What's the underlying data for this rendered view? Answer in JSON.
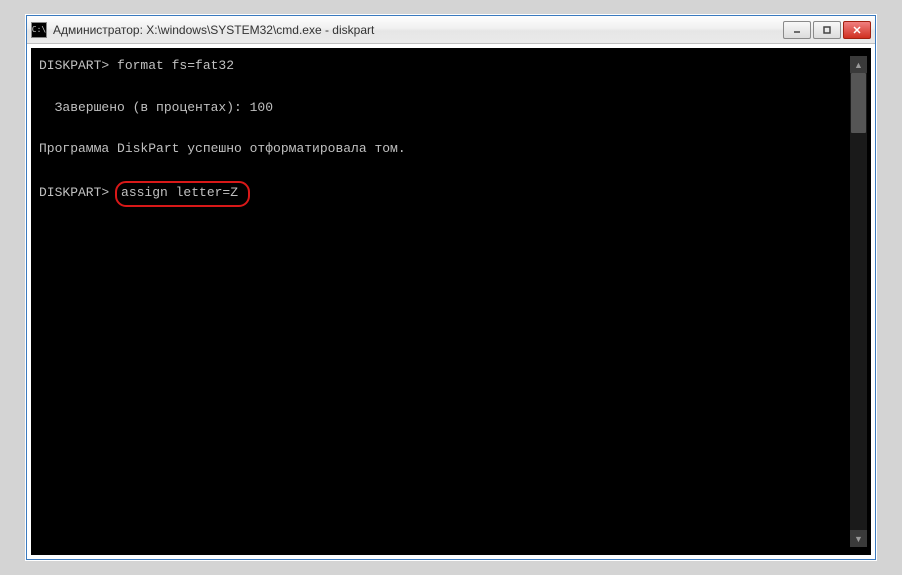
{
  "window": {
    "title": "Администратор: X:\\windows\\SYSTEM32\\cmd.exe - diskpart",
    "icon_label": "C:\\"
  },
  "console": {
    "lines": [
      {
        "prompt": "DISKPART>",
        "command": "format fs=fat32"
      },
      {
        "text": "  Завершено (в процентах): 100"
      },
      {
        "text": "Программа DiskPart успешно отформатировала том."
      },
      {
        "prompt": "DISKPART>",
        "command": "assign letter=Z",
        "highlighted": true
      }
    ]
  },
  "colors": {
    "highlight_border": "#d91818",
    "console_bg": "#000000",
    "console_fg": "#c0c0c0"
  }
}
